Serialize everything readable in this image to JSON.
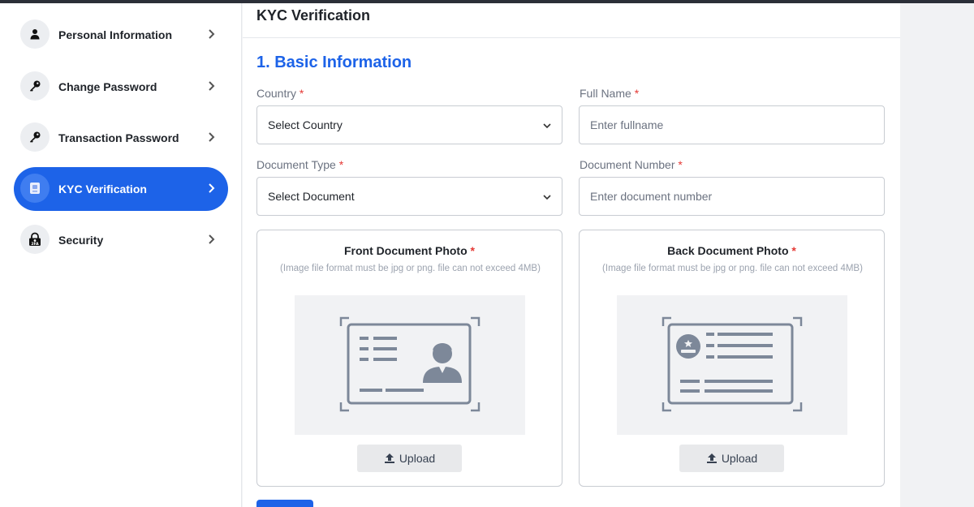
{
  "sidebar": {
    "items": [
      {
        "label": "Personal Information",
        "icon": "user-icon"
      },
      {
        "label": "Change Password",
        "icon": "key-icon"
      },
      {
        "label": "Transaction Password",
        "icon": "key-icon"
      },
      {
        "label": "KYC Verification",
        "icon": "id-card-icon",
        "active": true
      },
      {
        "label": "Security",
        "icon": "2fa-lock-icon",
        "badge": "2FA"
      }
    ]
  },
  "main": {
    "title": "KYC Verification",
    "section_title": "1. Basic Information",
    "fields": {
      "country": {
        "label": "Country",
        "required": "*",
        "value": "Select Country"
      },
      "full_name": {
        "label": "Full Name",
        "required": "*",
        "placeholder": "Enter fullname"
      },
      "document_type": {
        "label": "Document Type",
        "required": "*",
        "value": "Select Document"
      },
      "document_number": {
        "label": "Document Number",
        "required": "*",
        "placeholder": "Enter document number"
      }
    },
    "uploads": {
      "front": {
        "title": "Front Document Photo",
        "required": "*",
        "note": "(Image file format must be jpg or png. file can not exceed 4MB)",
        "button": "Upload"
      },
      "back": {
        "title": "Back Document Photo",
        "required": "*",
        "note": "(Image file format must be jpg or png. file can not exceed 4MB)",
        "button": "Upload"
      }
    }
  },
  "colors": {
    "accent": "#1d63e8",
    "required": "#e53935",
    "icon_gray": "#7d8899"
  }
}
